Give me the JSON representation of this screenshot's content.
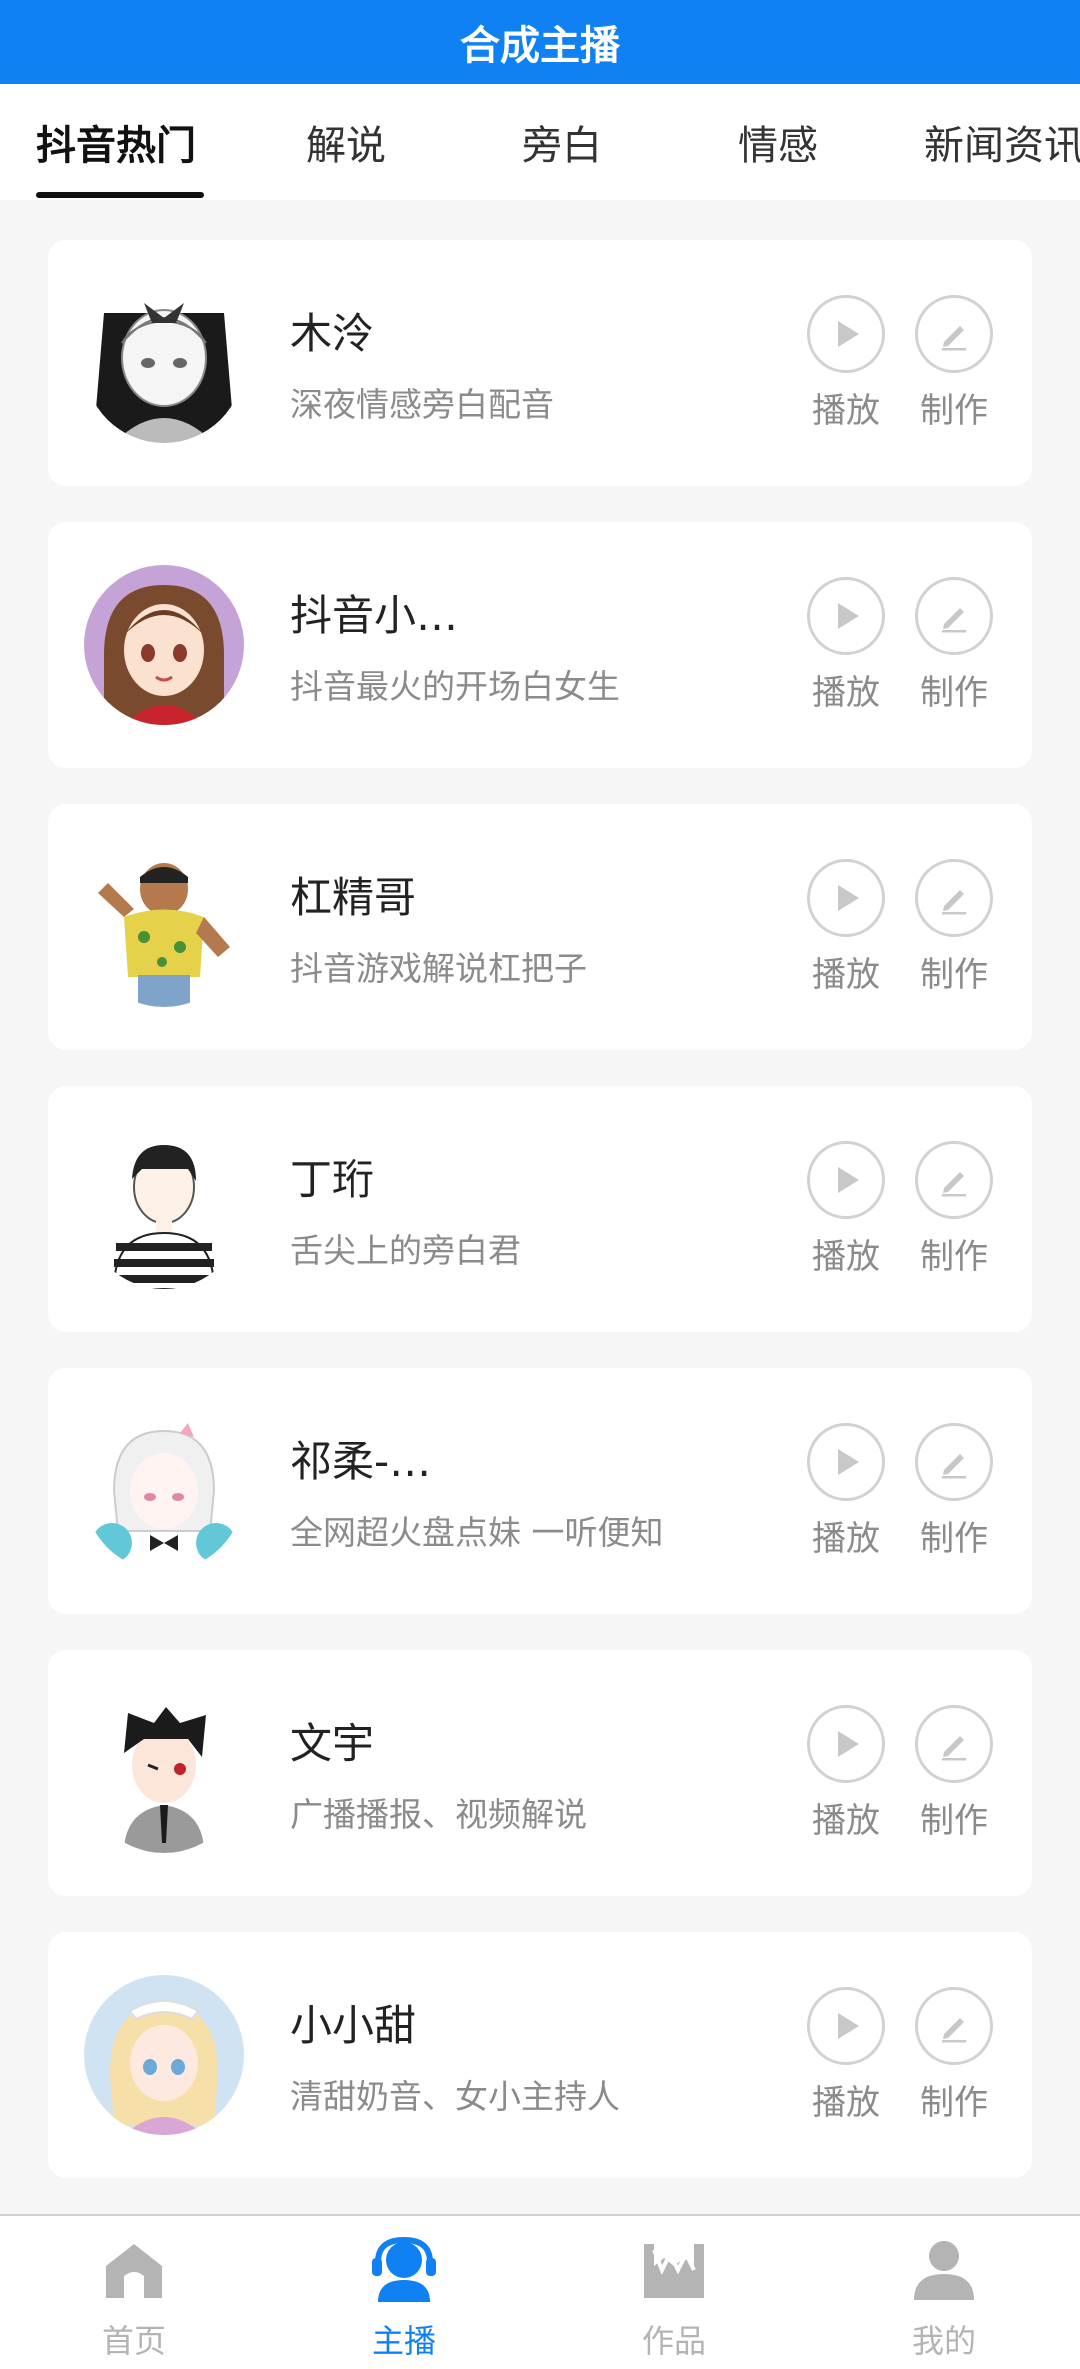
{
  "header": {
    "title": "合成主播"
  },
  "tabs": [
    {
      "label": "抖音热门",
      "active": true
    },
    {
      "label": "解说"
    },
    {
      "label": "旁白"
    },
    {
      "label": "情感"
    },
    {
      "label": "新闻资讯"
    }
  ],
  "anchors": [
    {
      "name": "木泠",
      "desc": "深夜情感旁白配音",
      "play_label": "播放",
      "make_label": "制作"
    },
    {
      "name": "抖音小…",
      "desc": "抖音最火的开场白女生",
      "play_label": "播放",
      "make_label": "制作"
    },
    {
      "name": "杠精哥",
      "desc": "抖音游戏解说杠把子",
      "play_label": "播放",
      "make_label": "制作"
    },
    {
      "name": "丁珩",
      "desc": "舌尖上的旁白君",
      "play_label": "播放",
      "make_label": "制作"
    },
    {
      "name": "祁柔-…",
      "desc": "全网超火盘点妹 一听便知",
      "play_label": "播放",
      "make_label": "制作"
    },
    {
      "name": "文宇",
      "desc": "广播播报、视频解说",
      "play_label": "播放",
      "make_label": "制作"
    },
    {
      "name": "小小甜",
      "desc": "清甜奶音、女小主持人",
      "play_label": "播放",
      "make_label": "制作"
    }
  ],
  "bottom_nav": [
    {
      "label": "首页",
      "icon": "home-icon"
    },
    {
      "label": "主播",
      "icon": "headset-user-icon",
      "active": true
    },
    {
      "label": "作品",
      "icon": "works-icon"
    },
    {
      "label": "我的",
      "icon": "profile-icon"
    }
  ],
  "colors": {
    "brand": "#1081f2",
    "muted_text": "#8b8b8b",
    "icon_gray": "#b4b4b4"
  }
}
